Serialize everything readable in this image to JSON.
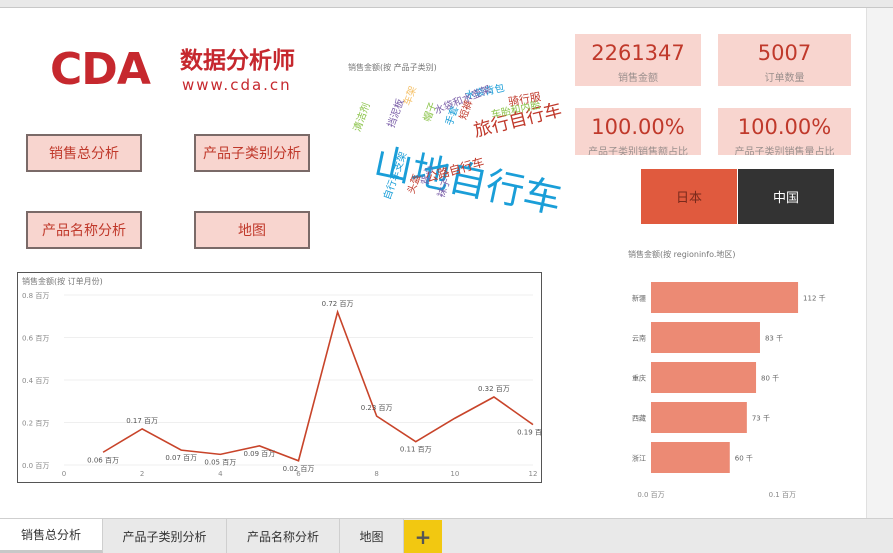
{
  "logo": {
    "brand": "CDA",
    "subtitle_zh": "数据分析师",
    "url": "www.cda.cn"
  },
  "nav_buttons": [
    "销售总分析",
    "产品子类别分析",
    "产品名称分析",
    "地图"
  ],
  "word_cloud": {
    "title": "销售金额(按 产品子类别)",
    "words": [
      {
        "text": "山地自行车",
        "color": "#1a9ed8"
      },
      {
        "text": "旅行自行车",
        "color": "#c0392b"
      },
      {
        "text": "公路自行车",
        "color": "#c0392b"
      },
      {
        "text": "水袋背包",
        "color": "#1a9ed8"
      },
      {
        "text": "骑行服",
        "color": "#c0392b"
      },
      {
        "text": "水袋和水壶架",
        "color": "#7a5ea8"
      },
      {
        "text": "车胎和内胎",
        "color": "#8bc34a"
      },
      {
        "text": "清洁剂",
        "color": "#8bc34a"
      },
      {
        "text": "自行车支架",
        "color": "#1a9ed8"
      },
      {
        "text": "背心",
        "color": "#7a5ea8"
      },
      {
        "text": "头盔",
        "color": "#c0392b"
      },
      {
        "text": "袜子",
        "color": "#7a5ea8"
      },
      {
        "text": "帽子",
        "color": "#8bc34a"
      },
      {
        "text": "挡泥板",
        "color": "#7a5ea8"
      },
      {
        "text": "手套",
        "color": "#1a9ed8"
      },
      {
        "text": "短裤",
        "color": "#c0392b"
      },
      {
        "text": "车架",
        "color": "#f5c26b"
      }
    ]
  },
  "kpis": [
    {
      "value": "2261347",
      "label": "销售金额"
    },
    {
      "value": "5007",
      "label": "订单数量"
    },
    {
      "value": "100.00%",
      "label": "产品子类别销售额占比"
    },
    {
      "value": "100.00%",
      "label": "产品子类别销售量占比"
    }
  ],
  "slicers": [
    {
      "label": "日本",
      "selected": true,
      "color": "#e05a3e"
    },
    {
      "label": "中国",
      "selected": false,
      "color": "#333333"
    }
  ],
  "line_chart": {
    "title": "销售金额(按 订单月份)",
    "chart_data": {
      "type": "line",
      "x": [
        1,
        2,
        3,
        4,
        5,
        6,
        7,
        8,
        9,
        10,
        11,
        12
      ],
      "values": [
        0.06,
        0.17,
        0.07,
        0.05,
        0.09,
        0.02,
        0.72,
        0.23,
        0.11,
        0.22,
        0.32,
        0.19
      ],
      "labels": [
        "0.06 百万",
        "0.17 百万",
        "0.07 百万",
        "0.05 百万",
        "0.09 百万",
        "0.02 百万",
        "0.72 百万",
        "0.23 百万",
        "0.11 百万",
        "",
        "0.32 百万",
        "0.19 百万"
      ],
      "yticks": [
        "0.0 百万",
        "0.2 百万",
        "0.4 百万",
        "0.6 百万",
        "0.8 百万"
      ],
      "ytick_values": [
        0,
        0.2,
        0.4,
        0.6,
        0.8
      ],
      "xticks": [
        0,
        2,
        4,
        6,
        8,
        10,
        12
      ],
      "ylim": [
        0,
        0.8
      ],
      "xlim": [
        0,
        12
      ],
      "line_color": "#c8442a"
    }
  },
  "bar_chart": {
    "title": "销售金额(按 regioninfo.地区)",
    "chart_data": {
      "type": "bar",
      "orientation": "horizontal",
      "categories": [
        "新疆",
        "云南",
        "重庆",
        "西藏",
        "浙江"
      ],
      "values": [
        112,
        83,
        80,
        73,
        60
      ],
      "labels": [
        "112 千",
        "83 千",
        "80 千",
        "73 千",
        "60 千"
      ],
      "xticks": [
        "0.0 百万",
        "0.1 百万"
      ],
      "xtick_values": [
        0,
        100
      ],
      "xlim": [
        0,
        115
      ],
      "bar_color": "#ec8a74"
    }
  },
  "tabs": [
    {
      "label": "销售总分析",
      "active": true
    },
    {
      "label": "产品子类别分析",
      "active": false
    },
    {
      "label": "产品名称分析",
      "active": false
    },
    {
      "label": "地图",
      "active": false
    }
  ],
  "add_tab_label": "+"
}
